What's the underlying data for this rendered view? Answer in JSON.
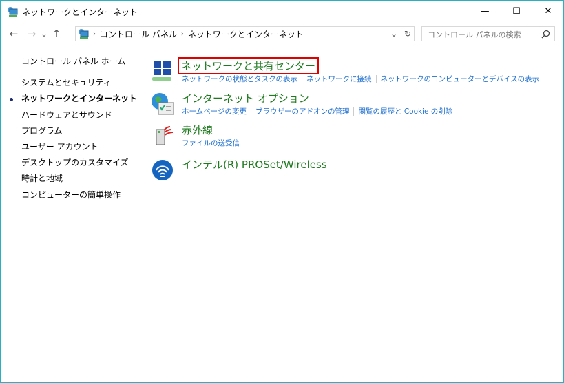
{
  "window": {
    "title": "ネットワークとインターネット",
    "controls": {
      "minimize": "—",
      "maximize": "☐",
      "close": "✕"
    }
  },
  "nav": {
    "back": "←",
    "forward": "→",
    "recent": "⌄",
    "up": "↑"
  },
  "address": {
    "crumbs": [
      "コントロール パネル",
      "ネットワークとインターネット"
    ],
    "dropdown": "⌄",
    "refresh": "↻"
  },
  "search": {
    "placeholder": "コントロール パネルの検索",
    "icon": "search-icon"
  },
  "sidebar": {
    "items": [
      "コントロール パネル ホーム",
      "システムとセキュリティ",
      "ネットワークとインターネット",
      "ハードウェアとサウンド",
      "プログラム",
      "ユーザー アカウント",
      "デスクトップのカスタマイズ",
      "時計と地域",
      "コンピューターの簡単操作"
    ],
    "current": 2
  },
  "categories": [
    {
      "title": "ネットワークと共有センター",
      "icon": "network-share-icon",
      "highlighted": true,
      "links": [
        "ネットワークの状態とタスクの表示",
        "ネットワークに接続",
        "ネットワークのコンピューターとデバイスの表示"
      ]
    },
    {
      "title": "インターネット オプション",
      "icon": "internet-options-icon",
      "links": [
        "ホームページの変更",
        "ブラウザーのアドオンの管理",
        "閲覧の履歴と Cookie の削除"
      ]
    },
    {
      "title": "赤外線",
      "icon": "infrared-icon",
      "links": [
        "ファイルの送受信"
      ]
    },
    {
      "title": "インテル(R) PROSet/Wireless",
      "icon": "wireless-icon",
      "links": []
    }
  ],
  "colors": {
    "heading": "#1f7a1f",
    "link": "#1e6fd0",
    "highlight": "#e00000",
    "border": "#2ab0c0"
  }
}
